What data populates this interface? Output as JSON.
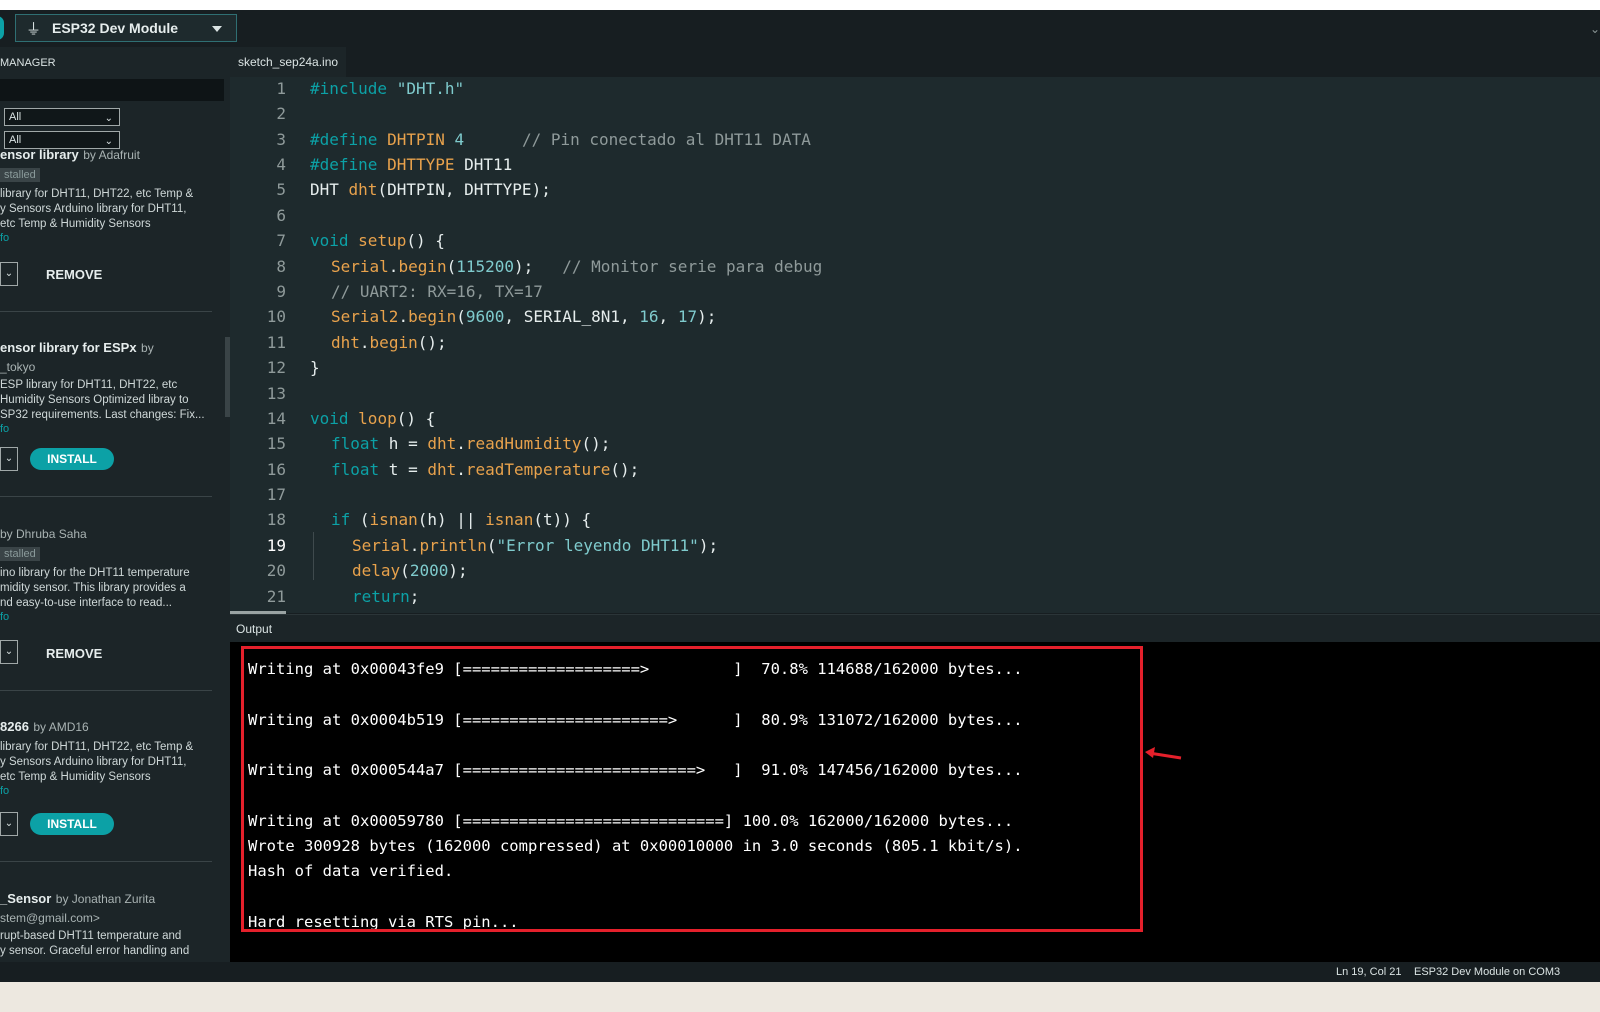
{
  "toolbar": {
    "board": "ESP32 Dev Module",
    "right_glyph": "⌄"
  },
  "sidebar": {
    "title": "MANAGER",
    "filter_type": "All",
    "filter_topic": "All",
    "libraries": [
      {
        "name": "ensor library",
        "by": "by Adafruit",
        "tag": "stalled",
        "desc": [
          " library for DHT11, DHT22, etc Temp &",
          "y Sensors Arduino library for DHT11,",
          "etc Temp & Humidity Sensors"
        ],
        "more": "fo",
        "action": "REMOVE"
      },
      {
        "name": "ensor library for ESPx",
        "by": "by",
        "by2": "_tokyo",
        "desc": [
          " ESP library for DHT11, DHT22, etc",
          "Humidity Sensors Optimized libray to",
          "SP32 requirements. Last changes: Fix..."
        ],
        "more": "fo",
        "action": "INSTALL"
      },
      {
        "name": "",
        "by": "by Dhruba Saha",
        "tag": "stalled",
        "desc": [
          "ino library for the DHT11 temperature",
          "midity sensor. This library provides a",
          "nd easy-to-use interface to read..."
        ],
        "more": "fo",
        "action": "REMOVE"
      },
      {
        "name": "8266",
        "by": "by AMD16",
        "desc": [
          " library for DHT11, DHT22, etc Temp &",
          "y Sensors Arduino library for DHT11,",
          "etc Temp & Humidity Sensors"
        ],
        "more": "fo",
        "action": "INSTALL"
      },
      {
        "name": "_Sensor",
        "by": "by Jonathan Zurita",
        "by2": "stem@gmail.com>",
        "desc": [
          "rupt-based DHT11 temperature and",
          "y sensor. Graceful error handling and"
        ]
      }
    ]
  },
  "tab": {
    "filename": "sketch_sep24a.ino"
  },
  "code": {
    "line_numbers": [
      "1",
      "2",
      "3",
      "4",
      "5",
      "6",
      "7",
      "8",
      "9",
      "10",
      "11",
      "12",
      "13",
      "14",
      "15",
      "16",
      "17",
      "18",
      "19",
      "20",
      "21"
    ],
    "active_line": "19",
    "t": {
      "l1a": "#include ",
      "l1b": "\"DHT.h\"",
      "define": "#define ",
      "dhtpin": "DHTPIN ",
      "four": "4",
      "c3": "      // Pin conectado al DHT11 DATA",
      "dhttype": "DHTTYPE ",
      "dht11": "DHT11",
      "l5a": "DHT ",
      "l5b": "dht",
      "l5c": "(DHTPIN, DHTTYPE);",
      "void": "void ",
      "setup": "setup",
      "open": "() {",
      "serial": "Serial",
      "dot": ".",
      "begin": "begin",
      "baud": "115200",
      "semi_close": ");",
      "c8": "   // Monitor serie para debug",
      "c9": "// UART2: RX=16, TX=17",
      "serial2": "Serial2",
      "paren": "(",
      "b9600": "9600",
      "mode": ", SERIAL_8N1, ",
      "n16": "16",
      "comma": ", ",
      "n17": "17",
      "dhtobj": "dht",
      "close_call": "();",
      "brace": "}",
      "loop": "loop",
      "float": "float ",
      "hvar": "h = ",
      "tvar": "t = ",
      "readHum": "readHumidity",
      "readTemp": "readTemperature",
      "if": "if ",
      "isnan": "isnan",
      "l18a": "(",
      "l18b": "(h) || ",
      "l18c": "(t)) {",
      "println": "println",
      "errstr": "\"Error leyendo DHT11\"",
      "delay": "delay",
      "n2000": "2000",
      "return": "return",
      "semi": ";"
    }
  },
  "output": {
    "title": "Output",
    "lines": [
      "Writing at 0x00043fe9 [===================>         ]  70.8% 114688/162000 bytes...",
      "Writing at 0x0004b519 [======================>      ]  80.9% 131072/162000 bytes...",
      "Writing at 0x000544a7 [=========================>   ]  91.0% 147456/162000 bytes...",
      "Writing at 0x00059780 [============================] 100.0% 162000/162000 bytes...",
      "Wrote 300928 bytes (162000 compressed) at 0x00010000 in 3.0 seconds (805.1 kbit/s).",
      "Hash of data verified.",
      "Hard resetting via RTS pin..."
    ]
  },
  "status": {
    "position": "Ln 19, Col 21",
    "board": "ESP32 Dev Module on COM3"
  },
  "colors": {
    "accent": "#0ca1a6",
    "highlight": "#e5202b"
  }
}
